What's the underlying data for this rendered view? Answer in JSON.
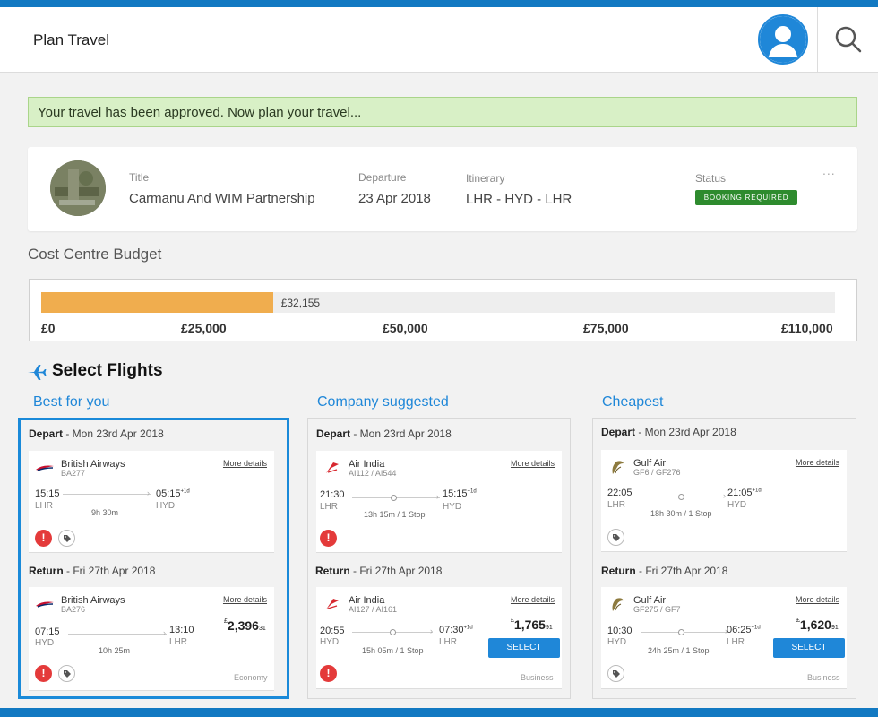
{
  "header": {
    "title": "Plan Travel"
  },
  "alert": {
    "text": "Your travel has been approved. Now plan your travel..."
  },
  "trip": {
    "title_label": "Title",
    "title_value": "Carmanu And WIM Partnership",
    "departure_label": "Departure",
    "departure_value": "23 Apr 2018",
    "itinerary_label": "Itinerary",
    "itinerary_value": "LHR - HYD - LHR",
    "status_label": "Status",
    "status_value": "BOOKING REQUIRED",
    "more": "..."
  },
  "budget": {
    "title": "Cost Centre Budget",
    "spent_label": "£32,155",
    "spent_fraction": 0.292,
    "ticks": [
      "£0",
      "£25,000",
      "£50,000",
      "£75,000",
      "£110,000"
    ]
  },
  "flights": {
    "title": "Select Flights",
    "columns": [
      {
        "title": "Best for you",
        "depart_head": "Depart",
        "depart_date": " - Mon 23rd Apr 2018",
        "depart": {
          "airline": "British Airways",
          "code": "BA277",
          "dep_time": "15:15",
          "dep_airport": "LHR",
          "arr_time": "05:15",
          "arr_plus": "+1d",
          "arr_airport": "HYD",
          "duration": "9h 30m",
          "more": "More details"
        },
        "return_head": "Return",
        "return_date": " - Fri 27th Apr 2018",
        "return": {
          "airline": "British Airways",
          "code": "BA276",
          "dep_time": "07:15",
          "dep_airport": "HYD",
          "arr_time": "13:10",
          "arr_plus": "",
          "arr_airport": "LHR",
          "duration": "10h 25m",
          "more": "More details"
        },
        "price_currency": "£",
        "price_main": "2,396",
        "price_pence": "31",
        "cabin": "Economy"
      },
      {
        "title": "Company suggested",
        "depart_head": "Depart",
        "depart_date": " - Mon 23rd Apr 2018",
        "depart": {
          "airline": "Air India",
          "code": "AI112 / AI544",
          "dep_time": "21:30",
          "dep_airport": "LHR",
          "arr_time": "15:15",
          "arr_plus": "+1d",
          "arr_airport": "HYD",
          "duration": "13h 15m / 1 Stop",
          "more": "More details"
        },
        "return_head": "Return",
        "return_date": " - Fri 27th Apr 2018",
        "return": {
          "airline": "Air India",
          "code": "AI127 / AI161",
          "dep_time": "20:55",
          "dep_airport": "HYD",
          "arr_time": "07:30",
          "arr_plus": "+1d",
          "arr_airport": "LHR",
          "duration": "15h 05m / 1 Stop",
          "more": "More details"
        },
        "price_currency": "£",
        "price_main": "1,765",
        "price_pence": "91",
        "select": "SELECT",
        "cabin": "Business"
      },
      {
        "title": "Cheapest",
        "depart_head": "Depart",
        "depart_date": " - Mon 23rd Apr 2018",
        "depart": {
          "airline": "Gulf Air",
          "code": "GF6 / GF276",
          "dep_time": "22:05",
          "dep_airport": "LHR",
          "arr_time": "21:05",
          "arr_plus": "+1d",
          "arr_airport": "HYD",
          "duration": "18h 30m / 1 Stop",
          "more": "More details"
        },
        "return_head": "Return",
        "return_date": " - Fri 27th Apr 2018",
        "return": {
          "airline": "Gulf Air",
          "code": "GF275 / GF7",
          "dep_time": "10:30",
          "dep_airport": "HYD",
          "arr_time": "06:25",
          "arr_plus": "+1d",
          "arr_airport": "LHR",
          "duration": "24h 25m / 1 Stop",
          "more": "More details"
        },
        "price_currency": "£",
        "price_main": "1,620",
        "price_pence": "91",
        "select": "SELECT",
        "cabin": "Business"
      }
    ]
  },
  "colors": {
    "accent": "#1f87d8",
    "budget_fill": "#f0ad4e",
    "status": "#2e8b2e",
    "warning": "#e43a3a",
    "alert_bg": "#d8f0c6"
  }
}
